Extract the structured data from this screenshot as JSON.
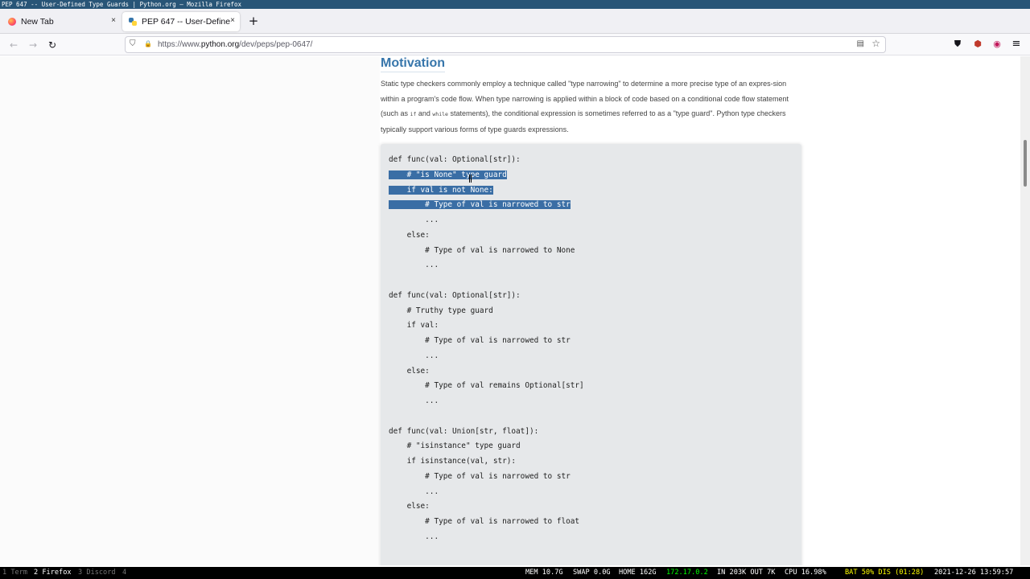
{
  "window_title": "PEP 647 -- User-Defined Type Guards | Python.org — Mozilla Firefox",
  "tabs": [
    {
      "label": "New Tab",
      "close": "×"
    },
    {
      "label": "PEP 647 -- User-Defined Type Guards | Python.org",
      "close": "×"
    }
  ],
  "new_tab_symbol": "+",
  "nav": {
    "back": "←",
    "forward": "→",
    "reload": "↻"
  },
  "url": {
    "prefix": "https://www.",
    "host": "python.org",
    "path": "/dev/peps/pep-0647/"
  },
  "icons": {
    "shield": "⛉",
    "lock": "🔒",
    "reader": "▤",
    "star": "☆",
    "pocket": "⛊",
    "extension": "⬢",
    "addon": "◉",
    "menu": "≡"
  },
  "page": {
    "heading": "Motivation",
    "para_part1": "Static type checkers commonly employ a technique called \"type narrowing\" to determine a more precise type of an expres-sion within a program's code flow. When type narrowing is applied within a block of code based on a conditional code flow statement (such as ",
    "code_if": "if",
    "para_and": " and ",
    "code_while": "while",
    "para_part2": " statements), the conditional expression is sometimes referred to as a \"type guard\". Python type checkers typically support various forms of type guards expressions.",
    "code": [
      "def func(val: Optional[str]):",
      "    # \"is None\" type guard",
      "    if val is not None:",
      "        # Type of val is narrowed to str",
      "        ...",
      "    else:",
      "        # Type of val is narrowed to None",
      "        ...",
      "",
      "def func(val: Optional[str]):",
      "    # Truthy type guard",
      "    if val:",
      "        # Type of val is narrowed to str",
      "        ...",
      "    else:",
      "        # Type of val remains Optional[str]",
      "        ...",
      "",
      "def func(val: Union[str, float]):",
      "    # \"isinstance\" type guard",
      "    if isinstance(val, str):",
      "        # Type of val is narrowed to str",
      "        ...",
      "    else:",
      "        # Type of val is narrowed to float",
      "        ..."
    ]
  },
  "statusbar": {
    "workspaces": [
      "1 Term",
      "2 Firefox",
      "3 Discord",
      "4"
    ],
    "mem": "MEM 10.7G",
    "swap": "SWAP 0.0G",
    "home": "HOME 162G",
    "ip": "172.17.0.2",
    "net": "IN 203K OUT 7K",
    "cpu": "CPU 16.98%",
    "bat": "BAT 50% DIS (01:28)",
    "datetime": "2021-12-26 13:59:57",
    "ip_color": "#00ff00",
    "bat_color": "#ffff00"
  }
}
